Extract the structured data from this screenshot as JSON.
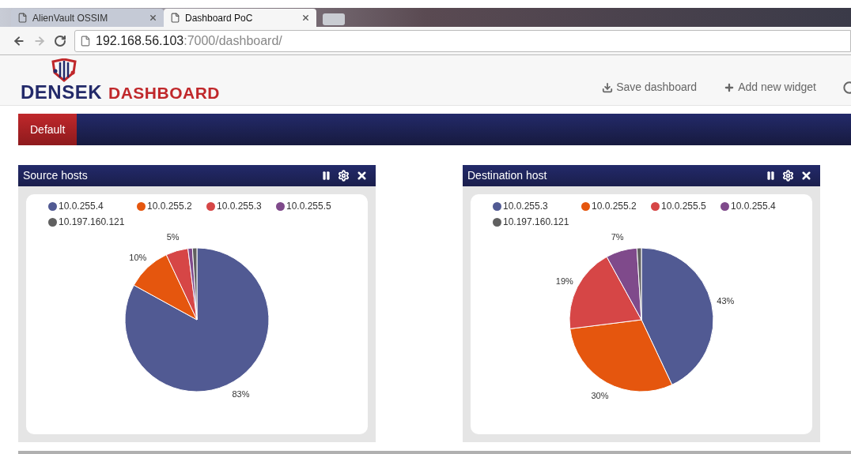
{
  "browser": {
    "tabs": [
      {
        "title": "AlienVault OSSIM",
        "selected": false
      },
      {
        "title": "Dashboard PoC",
        "selected": true
      }
    ],
    "url": {
      "host": "192.168.56.103",
      "path": ":7000/dashboard/"
    }
  },
  "header": {
    "logo": {
      "brand": "DENSEK",
      "product": "DASHBOARD"
    },
    "actions": [
      {
        "label": "Save dashboard",
        "kind": "save"
      },
      {
        "label": "Add new widget",
        "kind": "add"
      }
    ]
  },
  "nav": {
    "tabs": [
      {
        "label": "Default",
        "selected": true
      }
    ]
  },
  "widgets": [
    {
      "title": "Source hosts",
      "legend": [
        {
          "color": "#515a93"
        },
        {
          "color": "#e5560e"
        },
        {
          "color": "#d64646"
        },
        {
          "color": "#7f4a8b"
        },
        {
          "color": "#606060"
        }
      ],
      "chart_data": {
        "type": "pie",
        "categories": [
          "10.0.255.4",
          "10.0.255.2",
          "10.0.255.3",
          "10.0.255.5",
          "10.197.160.121"
        ],
        "values": [
          83,
          10,
          5,
          1,
          1
        ],
        "value_labels": [
          "83%",
          "10%",
          "5%",
          null,
          null
        ]
      }
    },
    {
      "title": "Destination host",
      "legend": [
        {
          "color": "#515a93"
        },
        {
          "color": "#e5560e"
        },
        {
          "color": "#d64646"
        },
        {
          "color": "#7f4a8b"
        },
        {
          "color": "#606060"
        }
      ],
      "chart_data": {
        "type": "pie",
        "categories": [
          "10.0.255.3",
          "10.0.255.2",
          "10.0.255.5",
          "10.0.255.4",
          "10.197.160.121"
        ],
        "values": [
          43,
          30,
          19,
          7,
          1
        ],
        "value_labels": [
          "43%",
          "30%",
          "19%",
          "7%",
          null
        ]
      }
    }
  ]
}
